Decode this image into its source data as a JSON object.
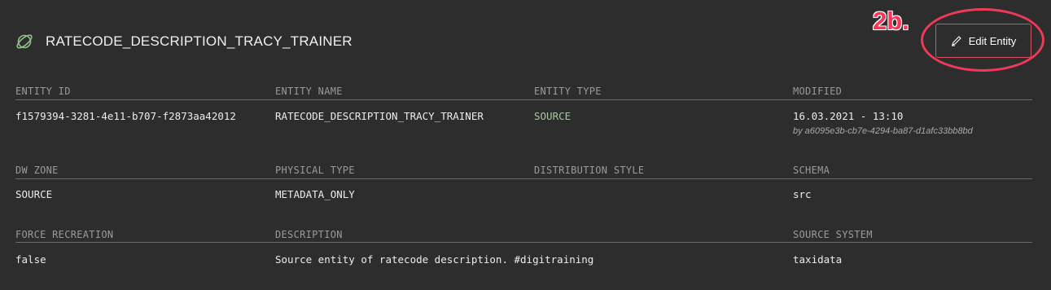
{
  "entity": {
    "title": "RATECODE_DESCRIPTION_TRACY_TRAINER",
    "icon": "entity-orbit-icon"
  },
  "annotation": {
    "label": "2b.",
    "color": "#ff3355"
  },
  "actions": {
    "edit_label": "Edit Entity",
    "edit_icon": "pen-icon"
  },
  "fields": {
    "row1": [
      {
        "label": "ENTITY ID",
        "value": "f1579394-3281-4e11-b707-f2873aa42012"
      },
      {
        "label": "ENTITY NAME",
        "value": "RATECODE_DESCRIPTION_TRACY_TRAINER"
      },
      {
        "label": "ENTITY TYPE",
        "value": "SOURCE"
      },
      {
        "label": "MODIFIED",
        "value": "16.03.2021 - 13:10",
        "sub": "by a6095e3b-cb7e-4294-ba87-d1afc33bb8bd"
      }
    ],
    "row2": [
      {
        "label": "DW ZONE",
        "value": "SOURCE"
      },
      {
        "label": "PHYSICAL TYPE",
        "value": "METADATA_ONLY"
      },
      {
        "label": "DISTRIBUTION STYLE",
        "value": ""
      },
      {
        "label": "SCHEMA",
        "value": "src"
      }
    ],
    "row3": [
      {
        "label": "FORCE RECREATION",
        "value": "false"
      },
      {
        "label": "DESCRIPTION",
        "value": "Source entity of ratecode description. #digitraining"
      },
      {
        "label": "SOURCE SYSTEM",
        "value": "taxidata"
      }
    ]
  },
  "colors": {
    "background": "#2d2d2d",
    "entity_type_value": "#a8c99a",
    "button_border": "#d9535e",
    "icon_green": "#8fbf8a"
  }
}
